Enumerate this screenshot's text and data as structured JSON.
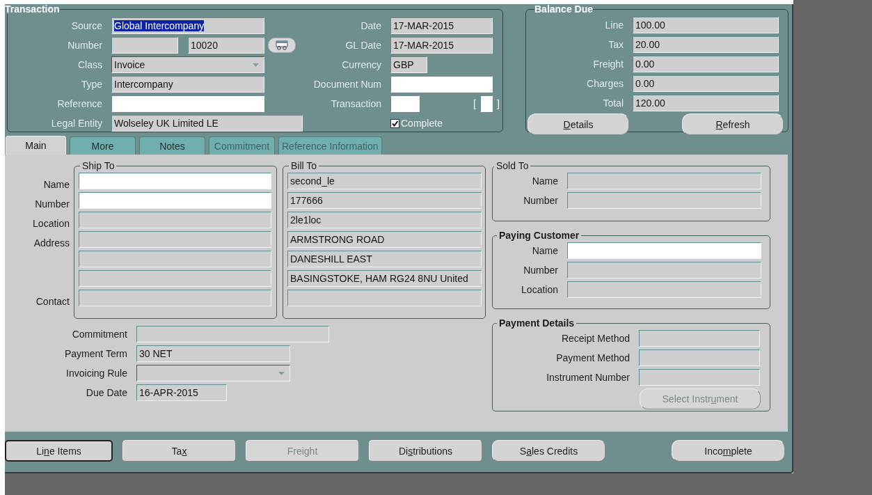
{
  "transaction": {
    "title": "Transaction",
    "left_fields": [
      {
        "kind": "text",
        "label": "Source",
        "value": "Global Intercompany",
        "text_selected": true,
        "editable": false
      },
      {
        "kind": "split",
        "label": "Number",
        "value": "10020",
        "editable": false
      },
      {
        "kind": "dropdown",
        "label": "Class",
        "value": "Invoice",
        "editable": false
      },
      {
        "kind": "text",
        "label": "Type",
        "value": "Intercompany",
        "editable": false
      },
      {
        "kind": "text",
        "label": "Reference",
        "editable": true
      },
      {
        "kind": "wide",
        "label": "Legal Entity",
        "value": "Wolseley UK Limited LE",
        "editable": false
      }
    ],
    "right_fields": [
      {
        "kind": "text",
        "label": "Date",
        "value": "17-MAR-2015",
        "editable": false
      },
      {
        "kind": "text",
        "label": "GL Date",
        "value": "17-MAR-2015",
        "editable": false
      },
      {
        "kind": "short",
        "label": "Currency",
        "value": "GBP",
        "editable": false
      },
      {
        "kind": "text",
        "label": "Document Num",
        "editable": true
      },
      {
        "kind": "flagged",
        "label": "Transaction",
        "editable": true,
        "brackets": [
          "[",
          "]"
        ]
      },
      {
        "kind": "checkbox",
        "label": "Complete",
        "checked": true
      }
    ]
  },
  "balance_due": {
    "title": "Balance Due",
    "lines": [
      {
        "label": "Line",
        "value": "100.00"
      },
      {
        "label": "Tax",
        "value": "20.00"
      },
      {
        "label": "Freight",
        "value": "0.00"
      },
      {
        "label": "Charges",
        "value": "0.00"
      },
      {
        "label": "Total",
        "value": "120.00"
      }
    ],
    "buttons": [
      {
        "label": [
          {
            "text": "D",
            "underlined": true
          },
          {
            "text": "etails",
            "underlined": false
          }
        ]
      },
      {
        "label": [
          {
            "text": "R",
            "underlined": true
          },
          {
            "text": "efresh",
            "underlined": false
          }
        ]
      }
    ]
  },
  "tabs": [
    {
      "label": "Main",
      "selected": true,
      "disabled": false
    },
    {
      "label": "More",
      "selected": false,
      "disabled": false
    },
    {
      "label": "Notes",
      "selected": false,
      "disabled": false
    },
    {
      "label": "Commitment",
      "selected": false,
      "disabled": true
    },
    {
      "label": "Reference Information",
      "selected": false,
      "disabled": true
    }
  ],
  "ship_to": {
    "title": "Ship To",
    "fields": [
      {
        "label": "Name",
        "editable": true
      },
      {
        "label": "Number",
        "editable": true
      },
      {
        "label": "Location",
        "editable": false
      },
      {
        "label": "Address",
        "editable": false
      },
      {
        "editable": false
      },
      {
        "editable": false
      },
      {
        "label": "Contact",
        "editable": false
      }
    ]
  },
  "bill_to": {
    "title": "Bill To",
    "fields": [
      {
        "value": "second_le",
        "editable": false
      },
      {
        "value": "177666",
        "editable": false
      },
      {
        "value": "2le1loc",
        "editable": false
      },
      {
        "value": "ARMSTRONG ROAD",
        "editable": false
      },
      {
        "value": "DANESHILL EAST",
        "editable": false
      },
      {
        "value": "BASINGSTOKE, HAM RG24 8NU United",
        "editable": false
      },
      {
        "editable": false
      }
    ]
  },
  "sold_to": {
    "title": "Sold To",
    "fields": [
      {
        "label": "Name",
        "editable": false
      },
      {
        "label": "Number",
        "editable": false
      }
    ]
  },
  "paying_customer": {
    "title": "Paying Customer",
    "fields": [
      {
        "label": "Name",
        "editable": true
      },
      {
        "label": "Number",
        "editable": false
      },
      {
        "label": "Location",
        "editable": false
      }
    ]
  },
  "payment_details": {
    "title": "Payment Details",
    "fields": [
      {
        "label": "Receipt Method"
      },
      {
        "label": "Payment Method"
      },
      {
        "label": "Instrument Number"
      }
    ],
    "button": {
      "label": [
        {
          "text": "Select Instr",
          "underlined": false
        },
        {
          "text": "u",
          "underlined": true
        },
        {
          "text": "ment",
          "underlined": false
        }
      ],
      "disabled": true
    }
  },
  "terms": [
    {
      "kind": "long",
      "label": "Commitment"
    },
    {
      "kind": "text",
      "label": "Payment Term",
      "value": "30 NET"
    },
    {
      "kind": "dropdown",
      "label": "Invoicing Rule"
    },
    {
      "kind": "short",
      "label": "Due Date",
      "value": "16-APR-2015"
    }
  ],
  "buttons": [
    {
      "label": [
        {
          "text": "Li",
          "underlined": false
        },
        {
          "text": "n",
          "underlined": true
        },
        {
          "text": "e Items",
          "underlined": false
        }
      ],
      "focused": true,
      "disabled": false
    },
    {
      "label": [
        {
          "text": "Ta",
          "underlined": false
        },
        {
          "text": "x",
          "underlined": true
        }
      ],
      "focused": false,
      "disabled": false
    },
    {
      "label": [
        {
          "text": "Freight",
          "underlined": false
        }
      ],
      "focused": false,
      "disabled": true
    },
    {
      "label": [
        {
          "text": "Di",
          "underlined": false
        },
        {
          "text": "s",
          "underlined": true
        },
        {
          "text": "tributions",
          "underlined": false
        }
      ],
      "focused": false,
      "disabled": false
    },
    {
      "label": [
        {
          "text": "S",
          "underlined": false
        },
        {
          "text": "a",
          "underlined": true
        },
        {
          "text": "les Credits",
          "underlined": false
        }
      ],
      "focused": false,
      "disabled": false
    },
    {
      "label": [
        {
          "text": "Inco",
          "underlined": false
        },
        {
          "text": "m",
          "underlined": true
        },
        {
          "text": "plete",
          "underlined": false
        }
      ],
      "focused": false,
      "disabled": false
    }
  ]
}
